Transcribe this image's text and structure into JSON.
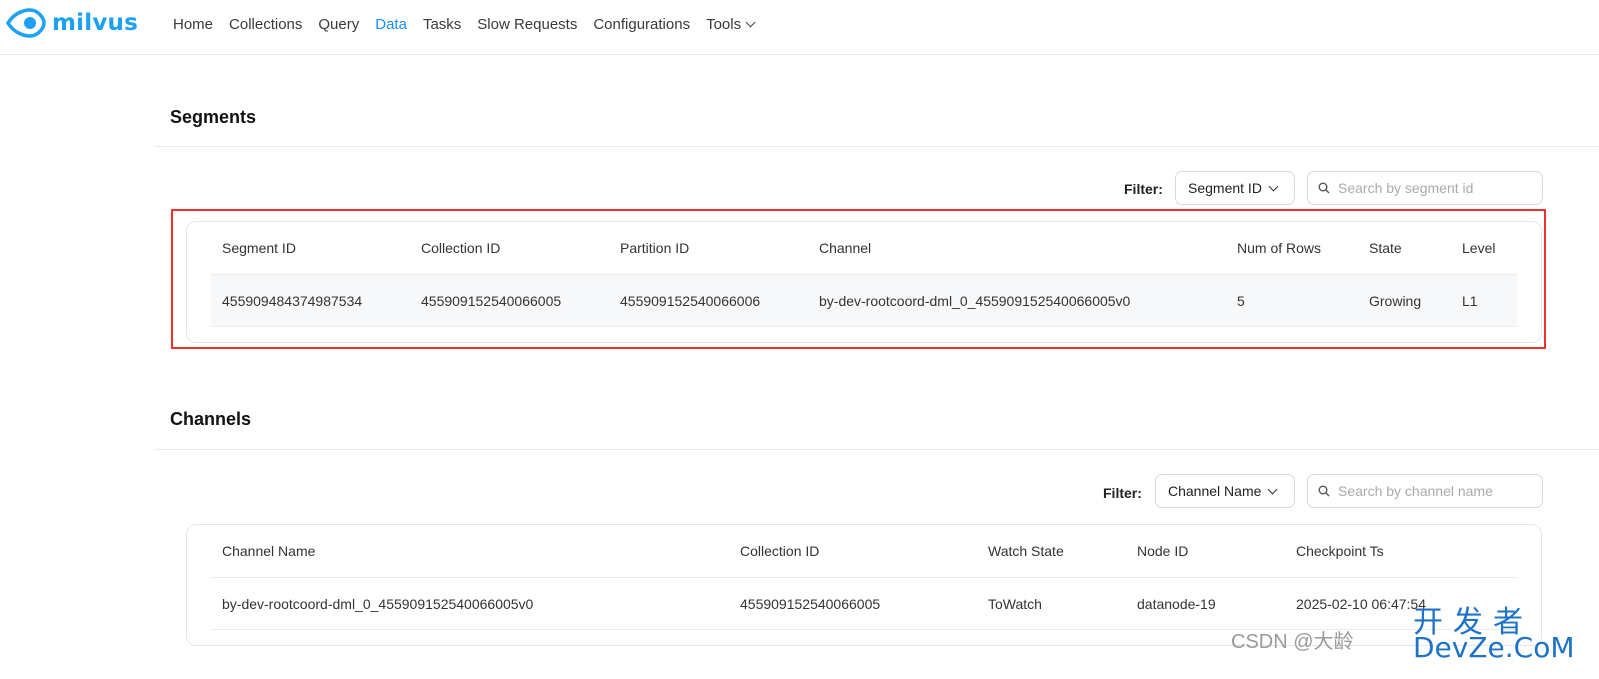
{
  "app": {
    "logo_text": "milvus"
  },
  "nav": {
    "items": [
      "Home",
      "Collections",
      "Query",
      "Data",
      "Tasks",
      "Slow Requests",
      "Configurations"
    ],
    "tools_label": "Tools",
    "active": "Data"
  },
  "segments": {
    "title": "Segments",
    "filter_label": "Filter:",
    "filter_select": "Segment ID",
    "search_placeholder": "Search by segment id",
    "columns": [
      "Segment ID",
      "Collection ID",
      "Partition ID",
      "Channel",
      "Num of Rows",
      "State",
      "Level"
    ],
    "rows": [
      [
        "455909484374987534",
        "455909152540066005",
        "455909152540066006",
        "by-dev-rootcoord-dml_0_455909152540066005v0",
        "5",
        "Growing",
        "L1"
      ]
    ]
  },
  "channels": {
    "title": "Channels",
    "filter_label": "Filter:",
    "filter_select": "Channel Name",
    "search_placeholder": "Search by channel name",
    "columns": [
      "Channel Name",
      "Collection ID",
      "Watch State",
      "Node ID",
      "Checkpoint Ts"
    ],
    "rows": [
      [
        "by-dev-rootcoord-dml_0_455909152540066005v0",
        "455909152540066005",
        "ToWatch",
        "datanode-19",
        "2025-02-10 06:47:54"
      ]
    ]
  },
  "watermark": {
    "csdn": "CSDN @大龄",
    "cn": "开发者",
    "brand": "DevZe.CoM"
  },
  "colors": {
    "accent": "#1890ff",
    "logo": "#1da1f2",
    "highlight": "#f03030"
  }
}
